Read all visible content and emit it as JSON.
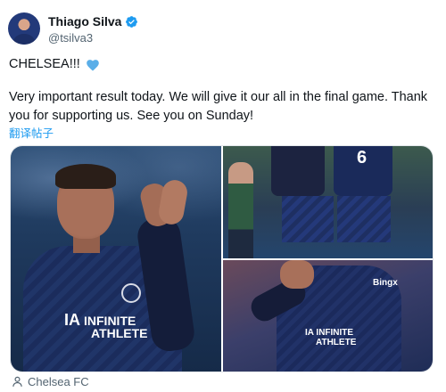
{
  "author": {
    "display_name": "Thiago Silva",
    "handle": "@tsilva3",
    "verified": true
  },
  "tweet": {
    "line1": "CHELSEA!!!",
    "body": "Very important result today. We will give it our all in the final game. Thank you for supporting us. See you on Sunday!",
    "translate_label": "翻译帖子"
  },
  "media": {
    "photos": [
      {
        "sponsor_mark": "IA",
        "sponsor_line1": "INFINITE",
        "sponsor_line2": "ATHLETE"
      },
      {
        "shirt_number": "6"
      },
      {
        "sponsor_mark": "IA",
        "sponsor_line1": "INFINITE",
        "sponsor_line2": "ATHLETE",
        "logo_text": "Bingx"
      }
    ]
  },
  "tagged": {
    "label": "Chelsea FC"
  },
  "colors": {
    "accent": "#1d9bf0",
    "heart": "#5aaee8",
    "text": "#0f1419",
    "muted": "#536471"
  },
  "icons": {
    "verified": "verified-badge-icon",
    "heart": "blue-heart-icon",
    "tag": "person-tag-icon"
  }
}
